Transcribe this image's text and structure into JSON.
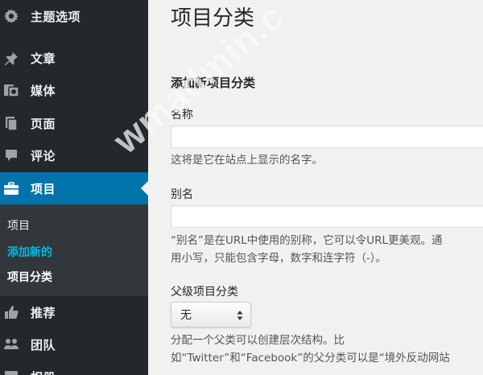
{
  "sidebar": {
    "items": [
      {
        "label": "主题选项",
        "icon": "gear-icon"
      },
      {
        "label": "文章",
        "icon": "pin-icon"
      },
      {
        "label": "媒体",
        "icon": "media-icon"
      },
      {
        "label": "页面",
        "icon": "page-icon"
      },
      {
        "label": "评论",
        "icon": "comment-icon"
      },
      {
        "label": "项目",
        "icon": "briefcase-icon",
        "active": true
      },
      {
        "label": "推荐",
        "icon": "thumbs-up-icon"
      },
      {
        "label": "团队",
        "icon": "groups-icon"
      },
      {
        "label": "相册",
        "icon": "gallery-icon"
      }
    ],
    "submenu": [
      {
        "label": "项目"
      },
      {
        "label": "添加新的"
      },
      {
        "label": "项目分类"
      }
    ],
    "colors": {
      "background": "#23282d",
      "active": "#0073aa",
      "submenu_bg": "#32373c",
      "highlight": "#00b9eb"
    }
  },
  "main": {
    "page_title": "项目分类",
    "section_title": "添加新项目分类",
    "name_field": {
      "label": "名称",
      "value": "",
      "description": "这将是它在站点上显示的名字。"
    },
    "slug_field": {
      "label": "别名",
      "value": "",
      "description_line1": "“别名”是在URL中使用的别称，它可以令URL更美观。通",
      "description_line2": "用小写，只能包含字母，数字和连字符（-）。"
    },
    "parent_field": {
      "label": "父级项目分类",
      "selected": "无",
      "description_line1": "分配一个父类可以创建层次结构。比",
      "description_line2": "如“Twitter”和“Facebook”的父分类可以是“境外反动网站"
    }
  },
  "watermark": "wmadmin.c"
}
